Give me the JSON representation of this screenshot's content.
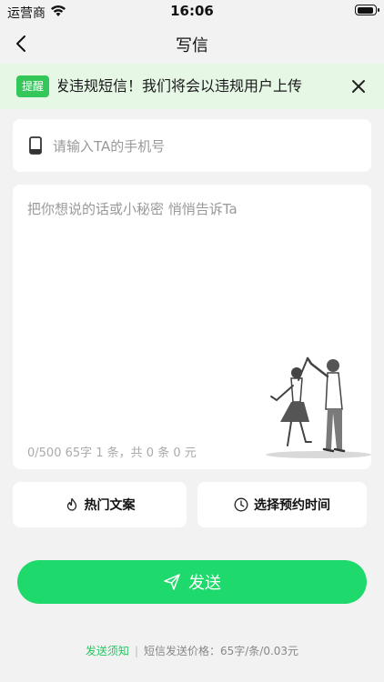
{
  "status_bar": {
    "carrier": "运营商",
    "time": "16:06",
    "battery_level": 0.9
  },
  "nav": {
    "title": "写信",
    "back_icon": "chevron-left-icon"
  },
  "notice": {
    "badge": "提醒",
    "text": "发违规短信！我们将会以违规用户上传",
    "close_icon": "close-icon"
  },
  "phone": {
    "placeholder": "请输入TA的手机号",
    "value": "",
    "icon": "mobile-phone-icon"
  },
  "message": {
    "placeholder": "把你想说的话或小秘密 悄悄告诉Ta",
    "value": "",
    "counter": "0/500 65字 1 条，共 0 条 0 元"
  },
  "actions": {
    "hot_label": "热门文案",
    "hot_icon": "flame-icon",
    "schedule_label": "选择预约时间",
    "schedule_icon": "clock-icon"
  },
  "send": {
    "label": "发送",
    "icon": "paper-plane-icon"
  },
  "footer": {
    "link": "发送须知",
    "separator": "|",
    "price": "短信发送价格：65字/条/0.03元"
  },
  "colors": {
    "accent": "#1ed96b",
    "notice_bg": "#e6f7e6",
    "badge": "#33c759"
  }
}
